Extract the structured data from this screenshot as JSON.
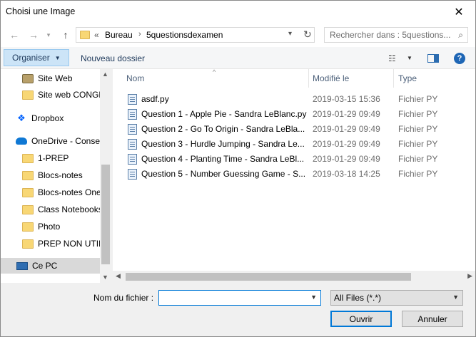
{
  "window": {
    "title": "Choisi une Image"
  },
  "address": {
    "prefix": "«",
    "crumbs": [
      "Bureau",
      "5questionsdexamen"
    ]
  },
  "search": {
    "placeholder": "Rechercher dans : 5questions..."
  },
  "toolbar": {
    "organiser_label": "Organiser",
    "new_folder_label": "Nouveau dossier"
  },
  "sidebar": {
    "items": [
      {
        "label": "Site Web",
        "icon": "users-folder-icon"
      },
      {
        "label": "Site web CONGR",
        "icon": "folder-icon"
      },
      {
        "label": "Dropbox",
        "icon": "dropbox-icon"
      },
      {
        "label": "OneDrive - Conse",
        "icon": "onedrive-icon"
      },
      {
        "label": "1-PREP",
        "icon": "folder-icon"
      },
      {
        "label": "Blocs-notes",
        "icon": "folder-icon"
      },
      {
        "label": "Blocs-notes One",
        "icon": "folder-icon"
      },
      {
        "label": "Class Notebooks",
        "icon": "folder-icon"
      },
      {
        "label": "Photo",
        "icon": "folder-icon"
      },
      {
        "label": "PREP NON UTILI",
        "icon": "folder-icon"
      },
      {
        "label": "Ce PC",
        "icon": "computer-icon"
      }
    ]
  },
  "columns": {
    "name": "Nom",
    "modified": "Modifié le",
    "type": "Type"
  },
  "files": [
    {
      "name": "asdf.py",
      "modified": "2019-03-15 15:36",
      "type": "Fichier PY"
    },
    {
      "name": "Question 1 - Apple Pie - Sandra LeBlanc.py",
      "modified": "2019-01-29 09:49",
      "type": "Fichier PY"
    },
    {
      "name": "Question 2 - Go To Origin - Sandra LeBla...",
      "modified": "2019-01-29 09:49",
      "type": "Fichier PY"
    },
    {
      "name": "Question 3 - Hurdle Jumping - Sandra Le...",
      "modified": "2019-01-29 09:49",
      "type": "Fichier PY"
    },
    {
      "name": "Question 4 - Planting Time - Sandra LeBl...",
      "modified": "2019-01-29 09:49",
      "type": "Fichier PY"
    },
    {
      "name": "Question 5 - Number Guessing Game - S...",
      "modified": "2019-03-18 14:25",
      "type": "Fichier PY"
    }
  ],
  "bottom": {
    "filename_label": "Nom du fichier :",
    "filename_value": "",
    "filter_value": "All Files (*.*)",
    "open_label": "Ouvrir",
    "cancel_label": "Annuler"
  }
}
